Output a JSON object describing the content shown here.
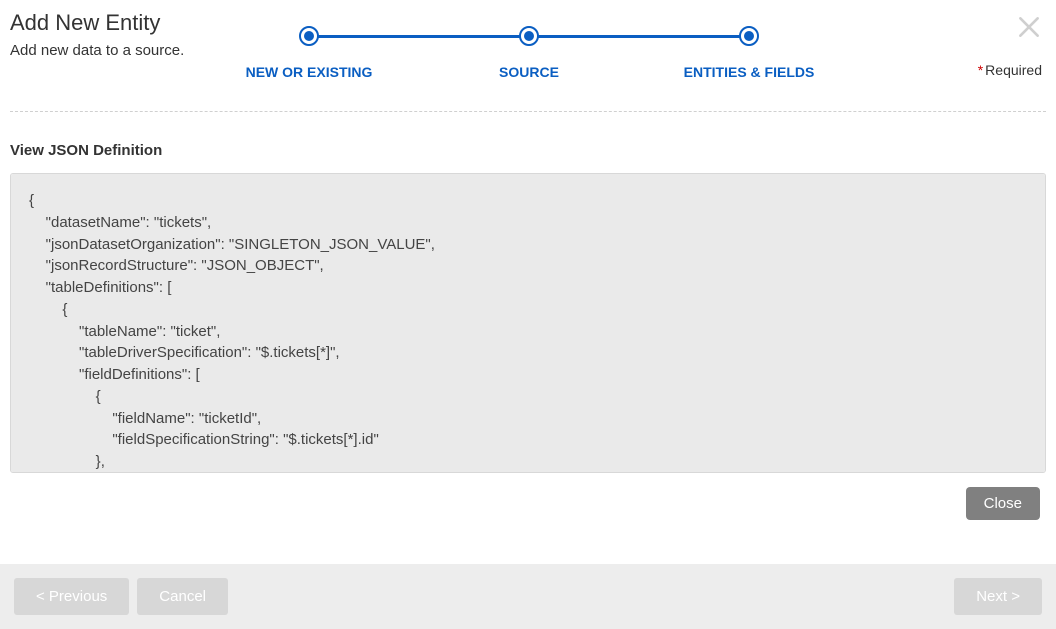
{
  "header": {
    "title": "Add New Entity",
    "subtitle": "Add new data to a source.",
    "required_label": "Required"
  },
  "stepper": {
    "step1": "NEW OR EXISTING",
    "step2": "SOURCE",
    "step3": "ENTITIES & FIELDS"
  },
  "section": {
    "view_json_title": "View JSON Definition",
    "json_text": "{\n    \"datasetName\": \"tickets\",\n    \"jsonDatasetOrganization\": \"SINGLETON_JSON_VALUE\",\n    \"jsonRecordStructure\": \"JSON_OBJECT\",\n    \"tableDefinitions\": [\n        {\n            \"tableName\": \"ticket\",\n            \"tableDriverSpecification\": \"$.tickets[*]\",\n            \"fieldDefinitions\": [\n                {\n                    \"fieldName\": \"ticketId\",\n                    \"fieldSpecificationString\": \"$.tickets[*].id\"\n                },"
  },
  "buttons": {
    "close": "Close",
    "previous": "< Previous",
    "cancel": "Cancel",
    "next": "Next >"
  }
}
